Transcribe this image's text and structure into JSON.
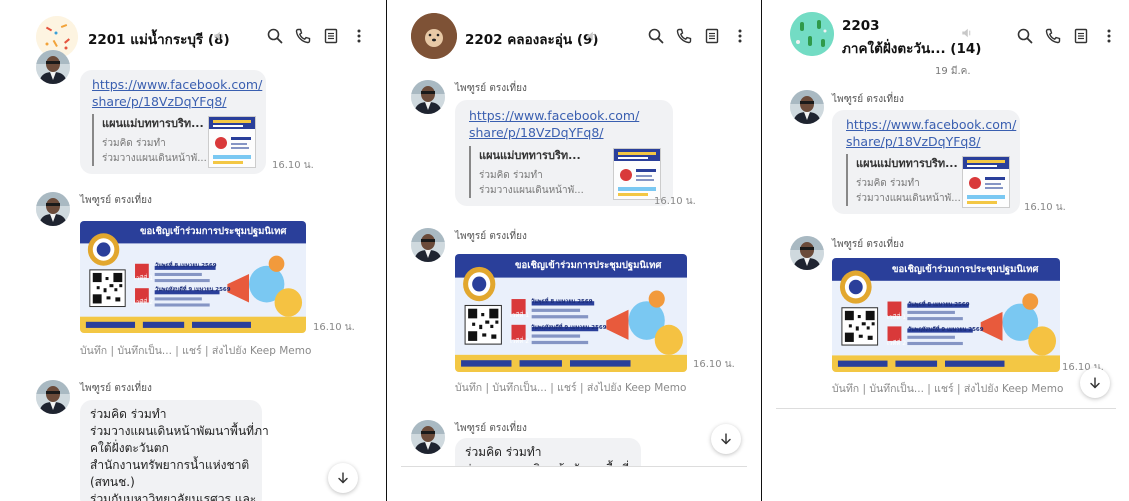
{
  "chats": [
    {
      "title": "2201 แม่น้ำกระบุรี (8)",
      "link": [
        "https://www.facebook.com/",
        "share/p/18VzDqYFq8/"
      ],
      "preview_title": "แผนแม่บททารบริท...",
      "preview_desc": [
        "ร่วมคิด ร่วมทำ",
        "ร่วมวางแผนเดินหน้าพั..."
      ],
      "time_link": "16.10 น.",
      "sender": "ไพฑูรย์ ตรงเที่ยง",
      "banner_title": "ขอเชิญเข้าร่วมการประชุมปฐมนิเทศ",
      "time_image": "16.10 น.",
      "actions": "บันทึก | บันทึกเป็น... | แชร์ | ส่งไปยัง Keep Memo",
      "text_lines": [
        "ร่วมคิด ร่วมทำ",
        "ร่วมวางแผนเดินหน้าพัฒนาพื้นที่ภา",
        "คใต้ฝั่งตะวันตก",
        "สำนักงานทรัพยากรน้ำแห่งชาติ",
        "(สทนช.)",
        "ร่วมกับมหาวิทยาลัยนเรศวร และ"
      ]
    },
    {
      "title": "2202 คลองละอุ่น (9)",
      "link": [
        "https://www.facebook.com/",
        "share/p/18VzDqYFq8/"
      ],
      "preview_title": "แผนแม่บททารบริท...",
      "preview_desc": [
        "ร่วมคิด ร่วมทำ",
        "ร่วมวางแผนเดินหน้าพั..."
      ],
      "time_link": "16.10 น.",
      "sender": "ไพฑูรย์ ตรงเที่ยง",
      "banner_title": "ขอเชิญเข้าร่วมการประชุมปฐมนิเทศ",
      "time_image": "16.10 น.",
      "actions": "บันทึก | บันทึกเป็น... | แชร์ | ส่งไปยัง Keep Memo",
      "text_lines": [
        "ร่วมคิด ร่วมทำ",
        "ร่วมวางแผนเดินหน้าพัฒนาพื้นที่ภา"
      ]
    },
    {
      "title_line1": "2203",
      "title_line2": "ภาคใต้ฝั่งตะวัน... (14)",
      "date": "19 มี.ค.",
      "link": [
        "https://www.facebook.com/",
        "share/p/18VzDqYFq8/"
      ],
      "preview_title": "แผนแม่บททารบริท...",
      "preview_desc": [
        "ร่วมคิด ร่วมทำ",
        "ร่วมวางแผนเดินหน้าพั..."
      ],
      "time_link": "16.10 น.",
      "sender": "ไพฑูรย์ ตรงเที่ยง",
      "banner_title": "ขอเชิญเข้าร่วมการประชุมปฐมนิเทศ",
      "time_image": "16.10 น.",
      "actions": "บันทึก | บันทึกเป็น... | แชร์ | ส่งไปยัง Keep Memo"
    }
  ],
  "banner_info": {
    "day1_label": "เวทีที่ 1",
    "day1_text": "วันพุธที่ 8 เมษายน 2569",
    "day2_label": "เวทีที่ 2",
    "day2_text": "วันพฤหัสบดีที่ 9 เมษายน 2569"
  }
}
